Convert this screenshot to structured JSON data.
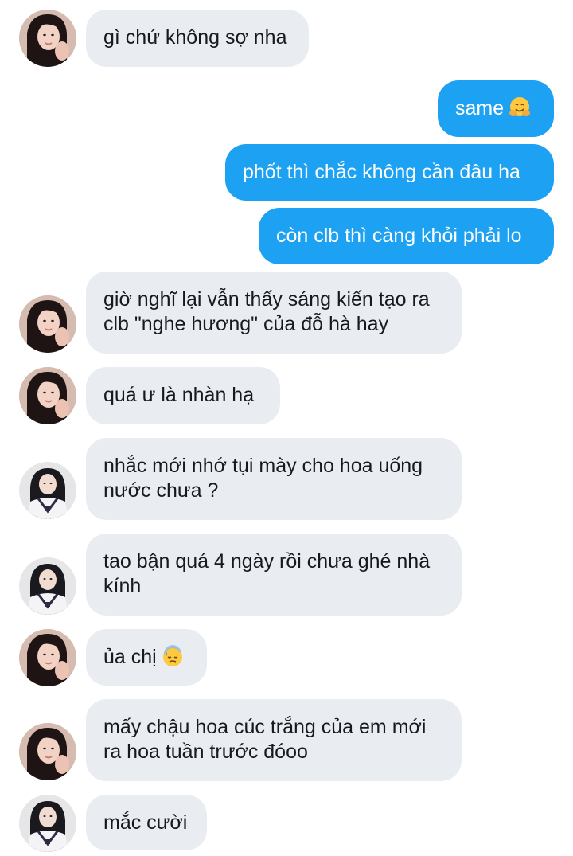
{
  "messages": [
    {
      "side": "in",
      "avatar": "avatar-a",
      "text": "gì chứ không sợ nha"
    },
    {
      "side": "out",
      "text": "same",
      "emoji": "hugging-face-emoji"
    },
    {
      "side": "out",
      "text": "phốt thì chắc không cần đâu ha"
    },
    {
      "side": "out",
      "text": "còn clb thì càng khỏi phải lo"
    },
    {
      "side": "in",
      "avatar": "avatar-a",
      "lines": [
        "giờ nghĩ lại vẫn thấy sáng kiến tạo ra",
        "clb \"nghe hương\" của đỗ hà hay"
      ]
    },
    {
      "side": "in",
      "avatar": "avatar-a",
      "text": "quá ư là nhàn hạ"
    },
    {
      "side": "in",
      "avatar": "avatar-b",
      "lines": [
        "nhắc mới nhớ tụi mày cho hoa uống",
        "nước chưa ?"
      ]
    },
    {
      "side": "in",
      "avatar": "avatar-b",
      "lines": [
        "tao bận quá 4 ngày rồi chưa ghé nhà",
        "kính"
      ]
    },
    {
      "side": "in",
      "avatar": "avatar-a",
      "text": "ủa chị",
      "emoji": "sweat-face-emoji"
    },
    {
      "side": "in",
      "avatar": "avatar-a",
      "lines": [
        "mấy chậu hoa cúc trắng của em mới",
        "ra hoa tuần trước đóoo"
      ]
    },
    {
      "side": "in",
      "avatar": "avatar-b",
      "text": "mắc cười"
    }
  ],
  "colors": {
    "incoming_bubble": "#e9edf1",
    "outgoing_bubble": "#1da1f2",
    "incoming_text": "#161a1e",
    "outgoing_text": "#ffffff"
  }
}
